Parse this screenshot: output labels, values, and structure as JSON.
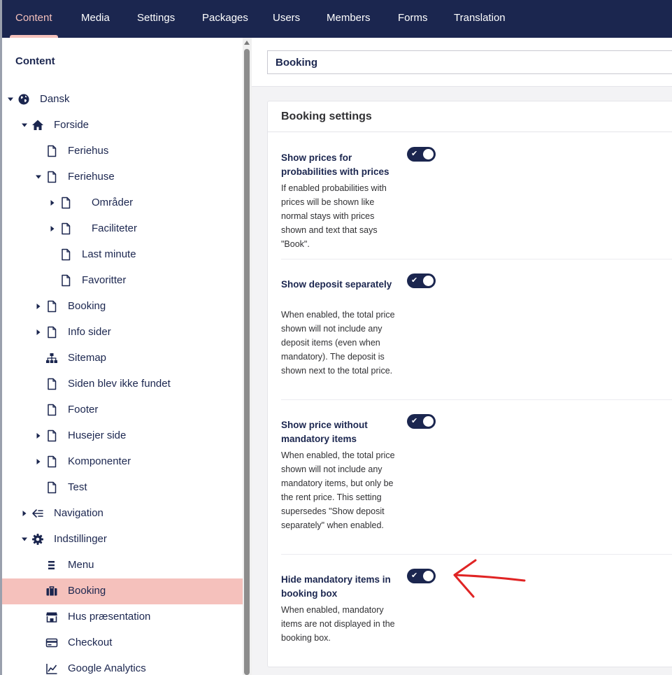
{
  "nav": {
    "tabs": [
      {
        "label": "Content",
        "active": true
      },
      {
        "label": "Media"
      },
      {
        "label": "Settings"
      },
      {
        "label": "Packages"
      },
      {
        "label": "Users"
      },
      {
        "label": "Members"
      },
      {
        "label": "Forms"
      },
      {
        "label": "Translation"
      }
    ]
  },
  "sidebar": {
    "title": "Content",
    "tree": [
      {
        "label": "Dansk",
        "icon": "globe-icon",
        "expanded": true
      },
      {
        "label": "Forside",
        "icon": "home-icon",
        "expanded": true
      },
      {
        "label": "Feriehus",
        "icon": "document-icon"
      },
      {
        "label": "Feriehuse",
        "icon": "document-icon",
        "expanded": true
      },
      {
        "label": "Områder",
        "icon": "document-icon",
        "expanded": false
      },
      {
        "label": "Faciliteter",
        "icon": "document-icon",
        "expanded": false
      },
      {
        "label": "Last minute",
        "icon": "document-icon"
      },
      {
        "label": "Favoritter",
        "icon": "document-icon"
      },
      {
        "label": "Booking",
        "icon": "document-icon",
        "expanded": false
      },
      {
        "label": "Info sider",
        "icon": "document-icon",
        "expanded": false
      },
      {
        "label": "Sitemap",
        "icon": "sitemap-icon"
      },
      {
        "label": "Siden blev ikke fundet",
        "icon": "document-icon"
      },
      {
        "label": "Footer",
        "icon": "document-icon"
      },
      {
        "label": "Husejer side",
        "icon": "document-icon",
        "expanded": false
      },
      {
        "label": "Komponenter",
        "icon": "document-icon",
        "expanded": false
      },
      {
        "label": "Test",
        "icon": "document-icon"
      },
      {
        "label": "Navigation",
        "icon": "navigation-icon",
        "expanded": false
      },
      {
        "label": "Indstillinger",
        "icon": "gear-icon",
        "expanded": true
      },
      {
        "label": "Menu",
        "icon": "menu-icon"
      },
      {
        "label": "Booking",
        "icon": "briefcase-icon",
        "selected": true
      },
      {
        "label": "Hus præsentation",
        "icon": "store-icon"
      },
      {
        "label": "Checkout",
        "icon": "credit-card-icon"
      },
      {
        "label": "Google Analytics",
        "icon": "chart-line-icon"
      }
    ]
  },
  "editor": {
    "name_value": "Booking",
    "group_title": "Booking settings",
    "properties": [
      {
        "label": "Show prices for probabilities with prices",
        "description": "If enabled probabilities with prices will be shown like normal stays with prices shown and text that says \"Book\".",
        "enabled": true,
        "toggle_icon": "check-icon"
      },
      {
        "label": "Show deposit separately",
        "description": "When enabled, the total price shown will not include any deposit items (even when mandatory). The deposit is shown next to the total price.",
        "enabled": true,
        "toggle_icon": "check-icon"
      },
      {
        "label": "Show price without mandatory items",
        "description": "When enabled, the total price shown will not include any mandatory items, but only be the rent price. This setting supersedes \"Show deposit separately\" when enabled.",
        "enabled": true,
        "toggle_icon": "check-icon"
      },
      {
        "label": "Hide mandatory items in booking box",
        "description": "When enabled, mandatory items are not displayed in the booking box.",
        "enabled": true,
        "toggle_icon": "check-icon"
      }
    ]
  },
  "annotation": {
    "icon": "arrow-left-icon",
    "color": "#e02424"
  },
  "colors": {
    "primary": "#1b264f",
    "accent": "#f5c1bc"
  }
}
